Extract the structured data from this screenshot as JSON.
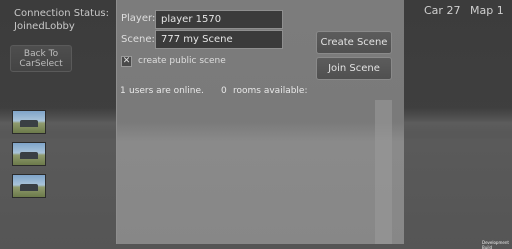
{
  "status": {
    "label": "Connection Status:",
    "value": "JoinedLobby"
  },
  "back_button": {
    "label": "Back To CarSelect"
  },
  "thumbnails": [
    {
      "icon": "map-thumbnail-1"
    },
    {
      "icon": "map-thumbnail-2"
    },
    {
      "icon": "map-thumbnail-3"
    }
  ],
  "hud": {
    "car": "Car 27",
    "map": "Map 1"
  },
  "panel": {
    "player_label": "Player:",
    "player_value": "player 1570",
    "scene_label": "Scene:",
    "scene_value": "777 my Scene",
    "create_button": "Create Scene",
    "join_button": "Join Scene",
    "checkbox_mark": "✕",
    "checkbox_label": "create public scene",
    "users_count": "1",
    "users_text": "users are online.",
    "rooms_count": "0",
    "rooms_text": "rooms available:"
  },
  "footer": {
    "dev_build": "Development Build"
  }
}
